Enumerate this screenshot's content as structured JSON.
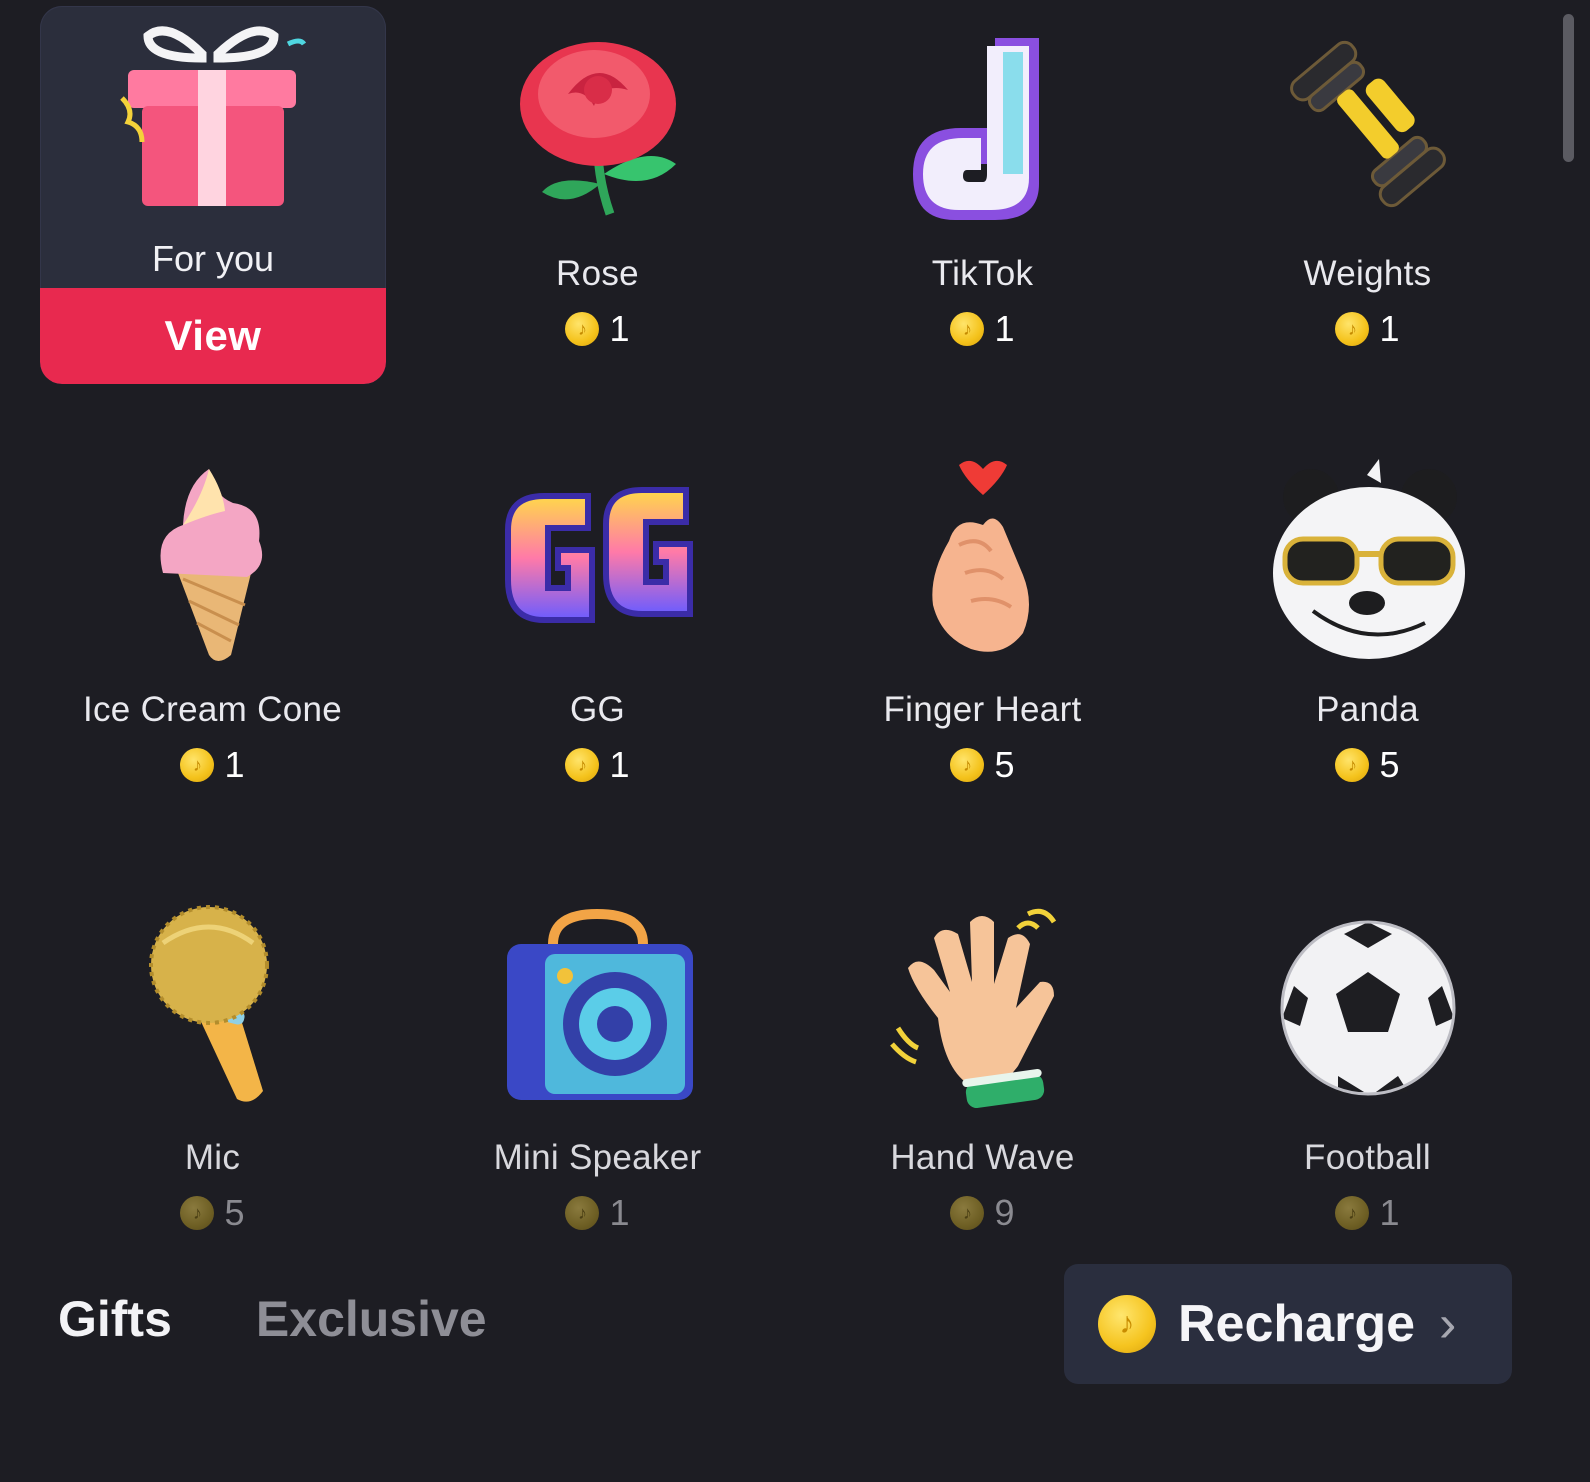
{
  "featured": {
    "label": "For you",
    "button": "View",
    "icon": "gift-box-icon"
  },
  "gifts": [
    {
      "name": "Rose",
      "price": "1",
      "icon": "rose-icon"
    },
    {
      "name": "TikTok",
      "price": "1",
      "icon": "tiktok-logo-icon"
    },
    {
      "name": "Weights",
      "price": "1",
      "icon": "dumbbell-icon"
    },
    {
      "name": "Ice Cream Cone",
      "price": "1",
      "icon": "ice-cream-icon"
    },
    {
      "name": "GG",
      "price": "1",
      "icon": "gg-text-icon"
    },
    {
      "name": "Finger Heart",
      "price": "5",
      "icon": "finger-heart-icon"
    },
    {
      "name": "Panda",
      "price": "5",
      "icon": "panda-icon"
    },
    {
      "name": "Mic",
      "price": "5",
      "icon": "microphone-icon"
    },
    {
      "name": "Mini Speaker",
      "price": "1",
      "icon": "speaker-icon"
    },
    {
      "name": "Hand Wave",
      "price": "9",
      "icon": "hand-wave-icon"
    },
    {
      "name": "Football",
      "price": "1",
      "icon": "soccer-ball-icon"
    }
  ],
  "tabs": [
    {
      "label": "Gifts",
      "active": true
    },
    {
      "label": "Exclusive",
      "active": false
    }
  ],
  "recharge": {
    "label": "Recharge",
    "chevron": "›",
    "icon": "coin-icon"
  },
  "colors": {
    "background": "#1d1d23",
    "accent": "#e8294f",
    "coin": "#f4c21b",
    "card": "#2b2e3c"
  }
}
